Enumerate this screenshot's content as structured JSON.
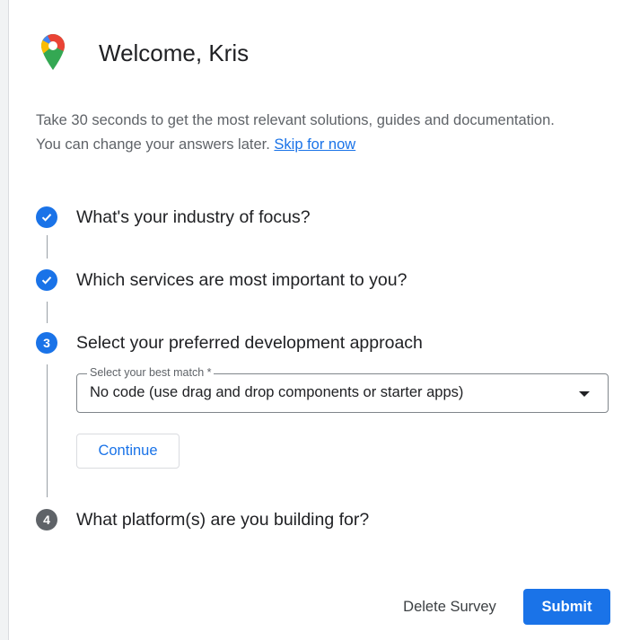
{
  "dialog": {
    "title": "Welcome, Kris",
    "intro_line1": "Take 30 seconds to get the most relevant solutions, guides and documentation.",
    "intro_line2": "You can change your answers later.",
    "skip_link": "Skip for now"
  },
  "steps": [
    {
      "number": "1",
      "status": "done",
      "label": "What's your industry of focus?"
    },
    {
      "number": "2",
      "status": "done",
      "label": "Which services are most important to you?"
    },
    {
      "number": "3",
      "status": "active",
      "label": "Select your preferred development approach"
    },
    {
      "number": "4",
      "status": "pending",
      "label": "What platform(s) are you building for?"
    }
  ],
  "select": {
    "legend": "Select your best match *",
    "value": "No code (use drag and drop components or starter apps)"
  },
  "buttons": {
    "continue": "Continue",
    "delete_survey": "Delete Survey",
    "submit": "Submit"
  },
  "colors": {
    "accent": "#1a73e8",
    "pending": "#5f6368"
  }
}
